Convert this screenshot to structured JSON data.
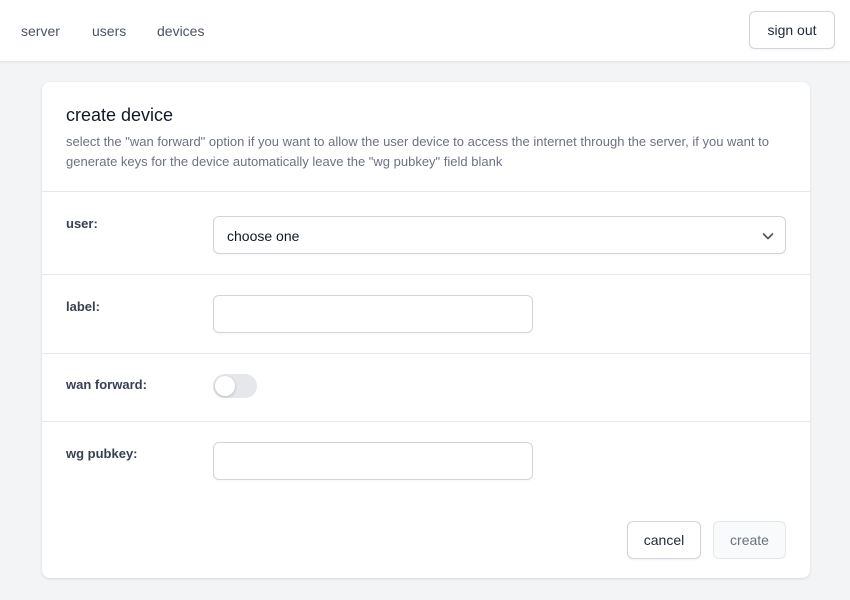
{
  "nav": {
    "links": [
      "server",
      "users",
      "devices"
    ],
    "signout_label": "sign out"
  },
  "form": {
    "title": "create device",
    "description": "select the \"wan forward\" option if you want to allow the user device to access the internet through the server, if you want to generate keys for the device automatically leave the \"wg pubkey\" field blank",
    "fields": {
      "user": {
        "label": "user:",
        "value": "choose one"
      },
      "label": {
        "label": "label:",
        "value": ""
      },
      "wan_forward": {
        "label": "wan forward:",
        "enabled": false
      },
      "wg_pubkey": {
        "label": "wg pubkey:",
        "value": ""
      }
    },
    "cancel_label": "cancel",
    "create_label": "create"
  },
  "icons": {
    "select": "chevron-down-icon"
  },
  "colors": {
    "toggle_off": "#e5e7eb",
    "background": "#f3f4f6"
  }
}
